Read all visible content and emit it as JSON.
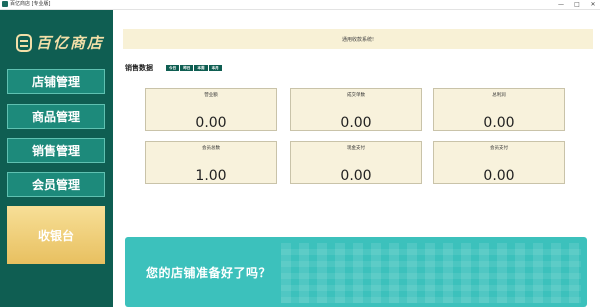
{
  "window": {
    "title": "百亿商店 [专业版]",
    "controls": [
      "—",
      "□",
      "✕"
    ]
  },
  "sidebar": {
    "logo_text": "百亿商店",
    "nav": [
      "店铺管理",
      "商品管理",
      "销售管理",
      "会员管理"
    ],
    "cashier_label": "收银台"
  },
  "notice": "通用收款系统!",
  "sales": {
    "title": "销售数据",
    "filters": [
      "今日",
      "昨日",
      "本周",
      "本月"
    ],
    "stats": [
      {
        "label": "营业额",
        "value": "0.00"
      },
      {
        "label": "成交单数",
        "value": "0.00"
      },
      {
        "label": "总利润",
        "value": "0.00"
      },
      {
        "label": "会员总数",
        "value": "1.00"
      },
      {
        "label": "现金支付",
        "value": "0.00"
      },
      {
        "label": "会员支付",
        "value": "0.00"
      }
    ]
  },
  "banner": {
    "headline": "您的店铺准备好了吗？"
  },
  "colors": {
    "sidebar": "#0f5e52",
    "nav_button": "#1d8a7b",
    "cashier": "#f0cf78",
    "card_bg": "#f8f2dc",
    "banner": "#3cc1bc"
  }
}
